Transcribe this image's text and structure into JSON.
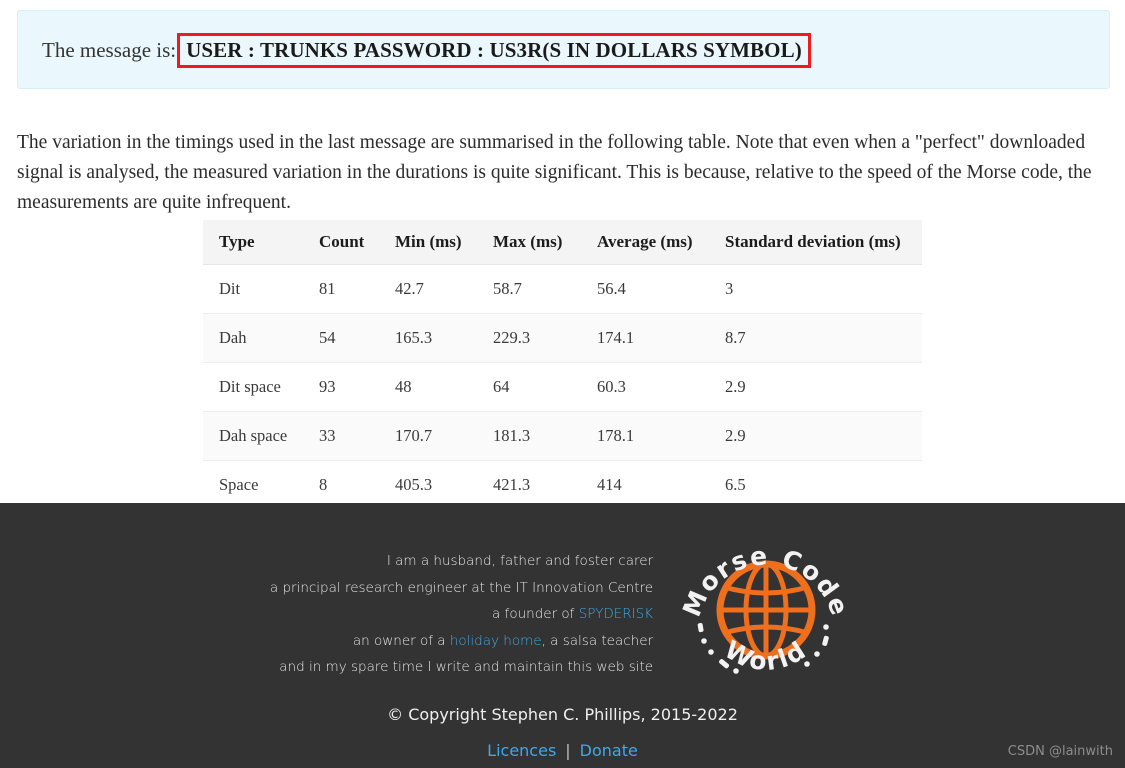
{
  "alert": {
    "label": "The message is:",
    "message": "USER : TRUNKS PASSWORD : US3R(S IN DOLLARS SYMBOL)",
    "border_color": "#ee1b20",
    "background_color": "#eaf7fc"
  },
  "paragraph": {
    "text": "The variation in the timings used in the last message are summarised in the following table. Note that even when a \"perfect\" downloaded signal is analysed, the measured variation in the durations is quite significant. This is because, relative to the speed of the Morse code, the measurements are quite infrequent."
  },
  "table": {
    "headers": [
      "Type",
      "Count",
      "Min (ms)",
      "Max (ms)",
      "Average (ms)",
      "Standard deviation (ms)"
    ],
    "rows": [
      {
        "type": "Dit",
        "count": "81",
        "min": "42.7",
        "max": "58.7",
        "average": "56.4",
        "sd": "3"
      },
      {
        "type": "Dah",
        "count": "54",
        "min": "165.3",
        "max": "229.3",
        "average": "174.1",
        "sd": "8.7"
      },
      {
        "type": "Dit space",
        "count": "93",
        "min": "48",
        "max": "64",
        "average": "60.3",
        "sd": "2.9"
      },
      {
        "type": "Dah space",
        "count": "33",
        "min": "170.7",
        "max": "181.3",
        "average": "178.1",
        "sd": "2.9"
      },
      {
        "type": "Space",
        "count": "8",
        "min": "405.3",
        "max": "421.3",
        "average": "414",
        "sd": "6.5"
      }
    ]
  },
  "footer": {
    "bio": {
      "line1": "I am a husband, father and foster carer",
      "line2": "a principal research engineer at the IT Innovation Centre",
      "line3_pre": "a founder of ",
      "line3_link": "SPYDERISK",
      "line4_pre": "an owner of a ",
      "line4_link": "holiday home",
      "line4_post": ", a salsa teacher",
      "line5": "and in my spare time I write and maintain this web site"
    },
    "logo": {
      "top_text": "Morse Code",
      "bottom_text": "World",
      "accent_color": "#ee6f1e"
    },
    "copyright": "© Copyright Stephen C. Phillips, 2015-2022",
    "links": {
      "licences": "Licences",
      "separator": "|",
      "donate": "Donate"
    },
    "background_color": "#333333",
    "link_color": "#3fa9e8"
  },
  "watermark": {
    "text": "CSDN @lainwith"
  }
}
